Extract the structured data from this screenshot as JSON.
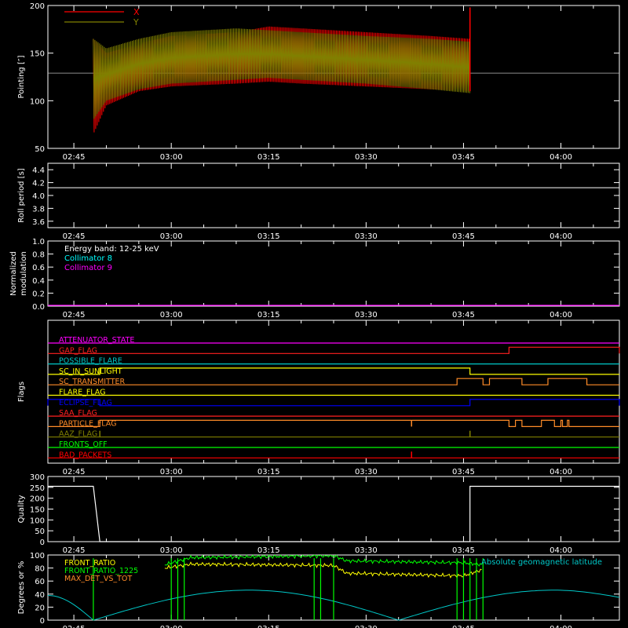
{
  "time_ticks": [
    "02:45",
    "03:00",
    "03:15",
    "03:30",
    "03:45",
    "04:00"
  ],
  "chart_data": [
    {
      "type": "line",
      "ylabel": "Pointing [″]",
      "ylim": [
        50,
        200
      ],
      "yticks": [
        50,
        100,
        150,
        200
      ],
      "legend": [
        "X",
        "Y"
      ],
      "colors": {
        "X": "#ff0000",
        "Y": "#808000"
      },
      "series": [
        {
          "name": "X",
          "x": [
            "02:48",
            "02:50",
            "02:55",
            "03:00",
            "03:10",
            "03:15",
            "03:20",
            "03:30",
            "03:40",
            "03:46"
          ],
          "min": [
            65,
            95,
            110,
            115,
            118,
            120,
            118,
            115,
            112,
            110
          ],
          "max": [
            165,
            150,
            160,
            168,
            172,
            178,
            176,
            172,
            168,
            165
          ]
        },
        {
          "name": "Y",
          "x": [
            "02:48",
            "02:50",
            "02:55",
            "03:00",
            "03:10",
            "03:15",
            "03:20",
            "03:30",
            "03:40",
            "03:46"
          ],
          "min": [
            80,
            100,
            112,
            118,
            122,
            124,
            122,
            118,
            112,
            108
          ],
          "max": [
            165,
            155,
            165,
            172,
            176,
            174,
            172,
            168,
            165,
            162
          ]
        }
      ],
      "reference_level": 129
    },
    {
      "type": "line",
      "ylabel": "Roll period [s]",
      "ylim": [
        3.5,
        4.5
      ],
      "yticks": [
        "3.6",
        "3.8",
        "4.0",
        "4.2",
        "4.4"
      ],
      "series": [
        {
          "x": [
            "02:41",
            "04:09"
          ],
          "y": [
            4.12,
            4.12
          ]
        }
      ]
    },
    {
      "type": "line",
      "ylabel": "Normalized modulation",
      "ylabel_lines": [
        "Normalized",
        "modulation"
      ],
      "ylim": [
        0,
        1
      ],
      "yticks": [
        "0.0",
        "0.2",
        "0.4",
        "0.6",
        "0.8",
        "1.0"
      ],
      "annotations": [
        "Energy band: 12-25 keV",
        "Collimator 8",
        "Collimator 9"
      ],
      "annotation_colors": [
        "#ffffff",
        "#00ffff",
        "#ff00ff"
      ],
      "series": [
        {
          "name": "Collimator 9",
          "y": 0
        }
      ]
    },
    {
      "type": "line",
      "ylabel": "Flags",
      "flags": [
        {
          "name": "ATTENUATOR_STATE",
          "color": "#ff00ff",
          "segments": []
        },
        {
          "name": "GAP_FLAG",
          "color": "#ff2020",
          "segments": [
            [
              "03:52",
              "04:09"
            ]
          ]
        },
        {
          "name": "POSSIBLE_FLARE",
          "color": "#00c8c8",
          "segments": []
        },
        {
          "name": "SC_IN_SUNLIGHT",
          "color": "#ffff00",
          "segments": [
            [
              "02:49",
              "03:46"
            ]
          ]
        },
        {
          "name": "SC_TRANSMITTER",
          "color": "#ff8c28",
          "segments": [
            [
              "03:44",
              "03:48"
            ],
            [
              "03:49",
              "03:54"
            ],
            [
              "03:58",
              "04:04"
            ]
          ]
        },
        {
          "name": "FLARE_FLAG",
          "color": "#ffff00",
          "segments": []
        },
        {
          "name": "ECLIPSE_FLAG",
          "color": "#0000ff",
          "segments": [
            [
              "02:41",
              "02:49"
            ],
            [
              "03:46",
              "04:09"
            ]
          ]
        },
        {
          "name": "SAA_FLAG",
          "color": "#ff2020",
          "segments": []
        },
        {
          "name": "PARTICLE_FLAG",
          "color": "#ff8c28",
          "segments": [
            [
              "02:49",
              "03:52"
            ],
            [
              "03:53",
              "03:54"
            ],
            [
              "03:57",
              "03:59"
            ],
            [
              "04:00",
              "04:00"
            ],
            [
              "04:01",
              "04:01"
            ]
          ],
          "spikes": [
            "03:37"
          ]
        },
        {
          "name": "AAZ_FLAG",
          "color": "#808000",
          "segments": [],
          "spikes": [
            "02:49",
            "03:46"
          ]
        },
        {
          "name": "FRONTS_OFF",
          "color": "#00ff00",
          "segments": []
        },
        {
          "name": "BAD_PACKETS",
          "color": "#ff0000",
          "segments": [],
          "spikes": [
            "03:37"
          ]
        }
      ]
    },
    {
      "type": "line",
      "ylabel": "Quality",
      "ylim": [
        0,
        300
      ],
      "yticks": [
        0,
        50,
        100,
        150,
        200,
        250,
        300
      ],
      "series": [
        {
          "x": [
            "02:41",
            "02:48",
            "02:49",
            "03:46",
            "03:46",
            "04:09"
          ],
          "y": [
            255,
            255,
            0,
            0,
            255,
            255
          ]
        }
      ]
    },
    {
      "type": "line",
      "ylabel": "Degrees or %",
      "ylim": [
        0,
        100
      ],
      "yticks": [
        0,
        20,
        40,
        60,
        80,
        100
      ],
      "legend": [
        "FRONT_RATIO",
        "FRONT_RATIO_1225",
        "MAX_DET_VS_TOT"
      ],
      "legend_colors": [
        "#ffff00",
        "#00ff00",
        "#ff8c28"
      ],
      "right_label": "Absolute geomagnetic latitude",
      "right_label_color": "#00c8c8",
      "series": [
        {
          "name": "Absolute geomagnetic latitude",
          "x": [
            "02:41",
            "02:48",
            "03:12",
            "03:35",
            "03:59",
            "04:09"
          ],
          "y": [
            38,
            0,
            46,
            0,
            46,
            35
          ]
        },
        {
          "name": "FRONT_RATIO_1225",
          "x": [
            "02:59",
            "03:03",
            "03:25",
            "03:27",
            "03:45",
            "03:48"
          ],
          "y": [
            85,
            96,
            99,
            91,
            88,
            85
          ]
        },
        {
          "name": "FRONT_RATIO",
          "x": [
            "02:59",
            "03:03",
            "03:25",
            "03:27",
            "03:45",
            "03:48"
          ],
          "y": [
            80,
            86,
            84,
            72,
            68,
            78
          ]
        }
      ]
    }
  ]
}
